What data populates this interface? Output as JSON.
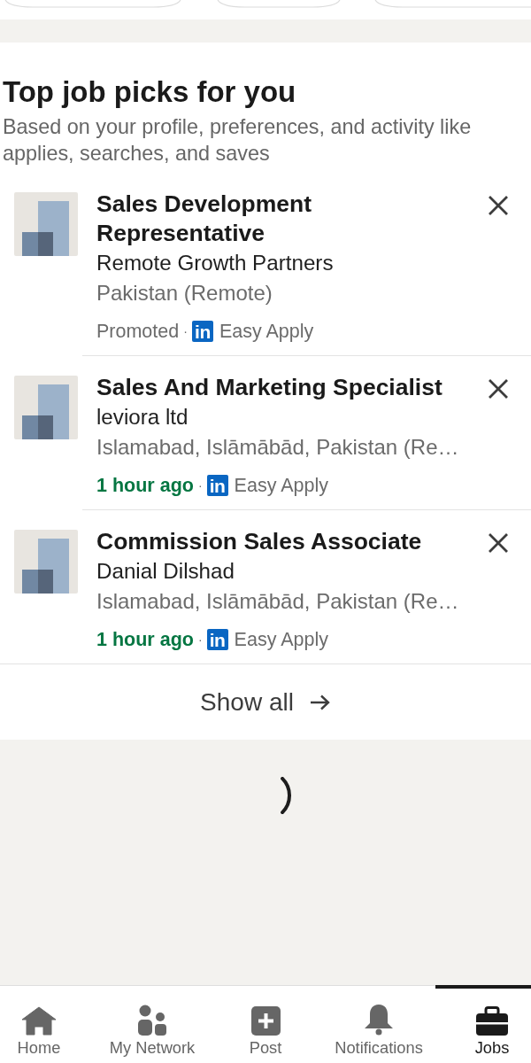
{
  "section": {
    "title": "Top job picks for you",
    "subtitle": "Based on your profile, preferences, and activity like applies, searches, and saves"
  },
  "jobs": [
    {
      "title": "Sales Development Representative",
      "company": "Remote Growth Partners",
      "location": "Pakistan (Remote)",
      "status": {
        "kind": "promoted",
        "label": "Promoted"
      },
      "separator": "·",
      "apply": {
        "badge": "in",
        "label": "Easy Apply"
      }
    },
    {
      "title": "Sales And Marketing Specialist",
      "company": "leviora ltd",
      "location": "Islamabad, Islāmābād, Pakistan (Re…",
      "status": {
        "kind": "recent",
        "label": "1 hour ago"
      },
      "separator": "·",
      "apply": {
        "badge": "in",
        "label": "Easy Apply"
      }
    },
    {
      "title": "Commission Sales Associate",
      "company": "Danial Dilshad",
      "location": "Islamabad, Islāmābād, Pakistan (Re…",
      "status": {
        "kind": "recent",
        "label": "1 hour ago"
      },
      "separator": "·",
      "apply": {
        "badge": "in",
        "label": "Easy Apply"
      }
    }
  ],
  "show_all": {
    "label": "Show all"
  },
  "feed": {
    "loading": true
  },
  "bottom_nav": [
    {
      "kind": "home",
      "label": "Home",
      "selected": false
    },
    {
      "kind": "network",
      "label": "My Network",
      "selected": false
    },
    {
      "kind": "post",
      "label": "Post",
      "selected": false
    },
    {
      "kind": "notifications",
      "label": "Notifications",
      "selected": false
    },
    {
      "kind": "jobs",
      "label": "Jobs",
      "selected": true
    }
  ]
}
